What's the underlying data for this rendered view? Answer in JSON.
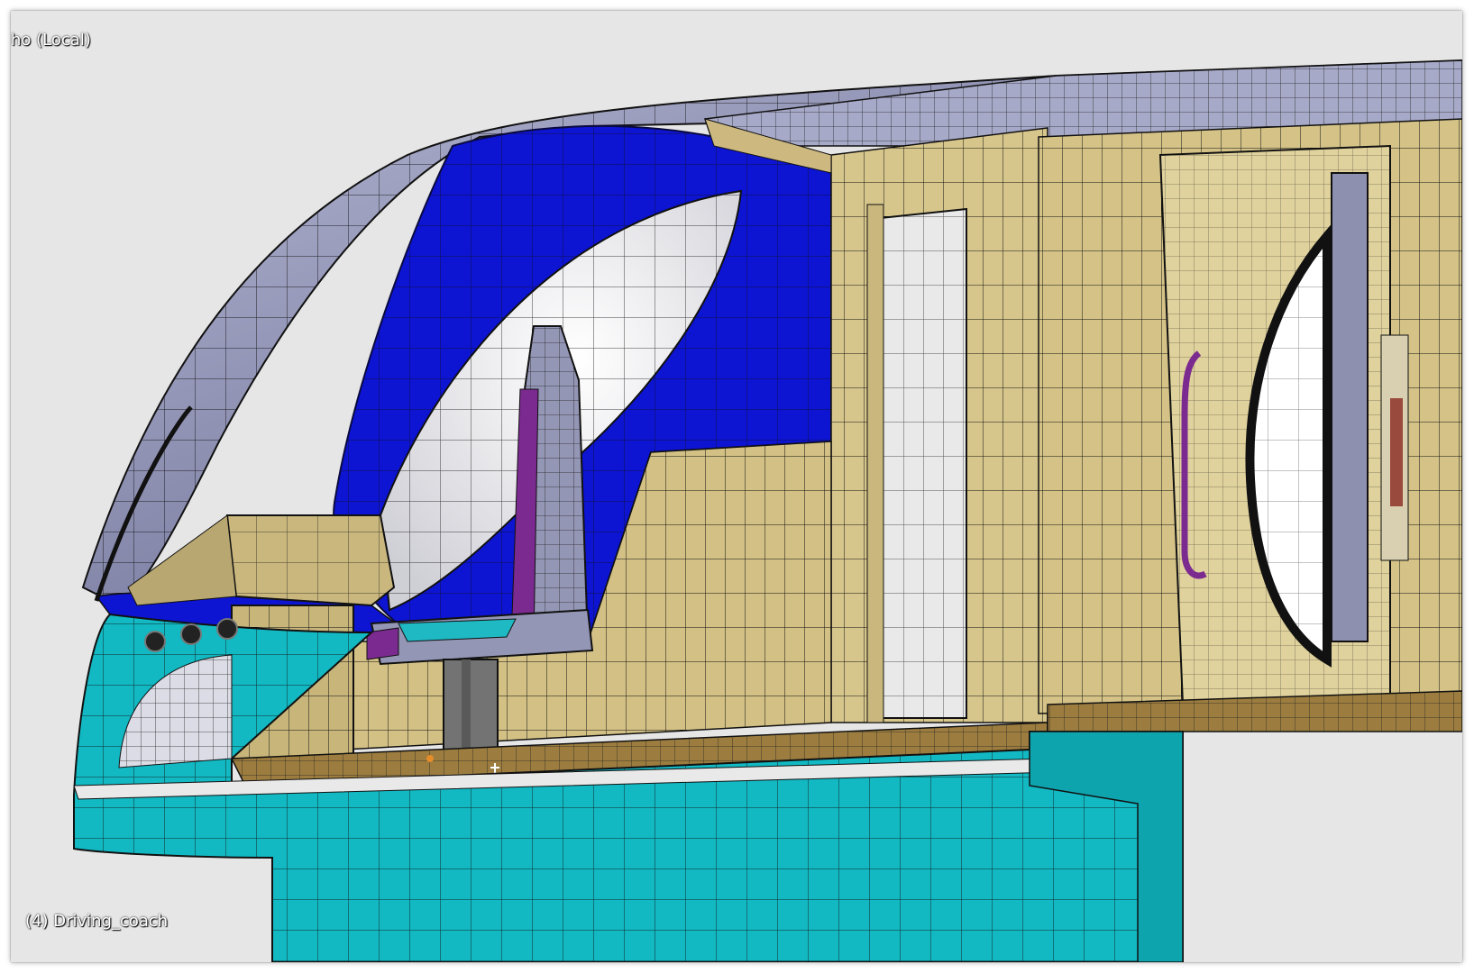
{
  "viewport": {
    "view_label": "ho (Local)",
    "object_label": "(4) Driving_coach",
    "background_color": "#e6e6e6"
  },
  "scene": {
    "object_name": "Driving_coach",
    "shading": "solid-wireframe",
    "colors": {
      "roof_lavender": "#9497b8",
      "window_band_blue": "#0d14d2",
      "interior_beige": "#d7c68c",
      "lower_body_cyan": "#12b8c2",
      "floor_brown": "#9c7d3f",
      "seat_purple": "#7b2a8f",
      "glass_white": "#f4f4f4"
    }
  }
}
